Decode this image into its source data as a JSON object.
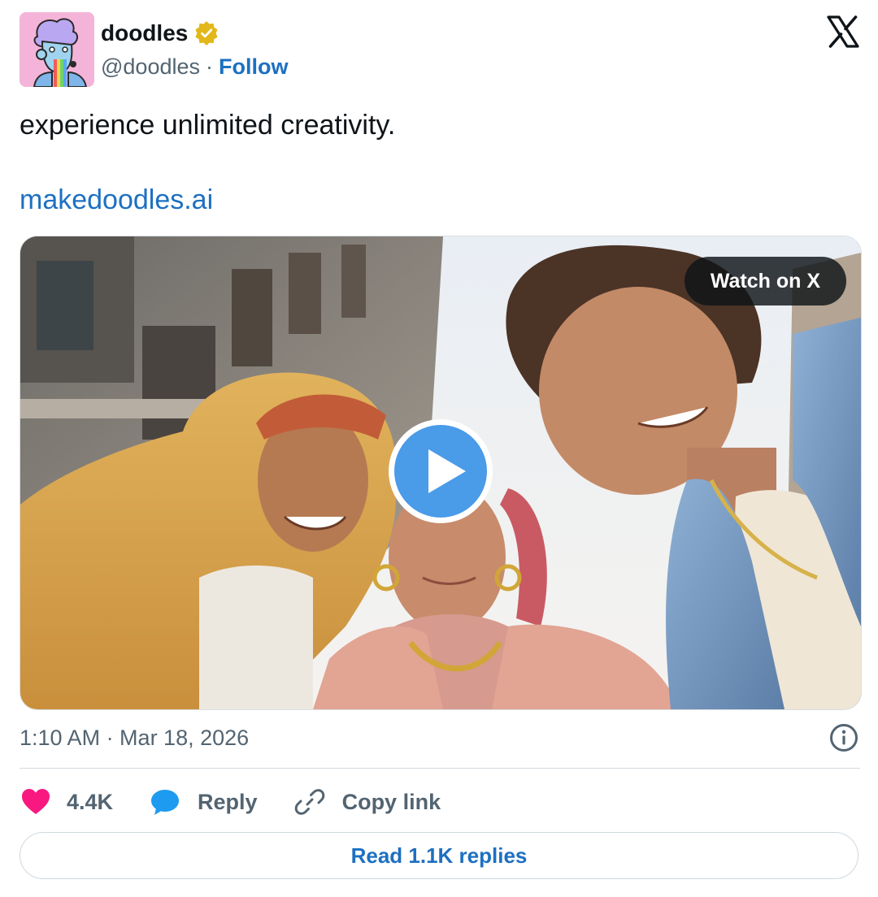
{
  "author": {
    "display_name": "doodles",
    "handle": "@doodles",
    "separator": "·",
    "follow_label": "Follow",
    "verified_badge_color": "#e2b719",
    "avatar_bg_color": "#f4b4d9"
  },
  "brand": {
    "logo": "x-logo-icon"
  },
  "tweet": {
    "text": "experience unlimited creativity.",
    "link_text": "makedoodles.ai",
    "link_color": "#1d70c2"
  },
  "media": {
    "watch_label": "Watch on X",
    "play_icon": "play-icon",
    "play_color": "#4a9be8"
  },
  "meta": {
    "timestamp": "1:10 AM · Mar 18, 2026",
    "info_icon": "info-icon"
  },
  "actions": {
    "likes_count": "4.4K",
    "like_color": "#f91880",
    "reply_label": "Reply",
    "reply_color": "#1d9bf0",
    "copy_label": "Copy link"
  },
  "footer": {
    "read_replies_label": "Read 1.1K replies"
  }
}
